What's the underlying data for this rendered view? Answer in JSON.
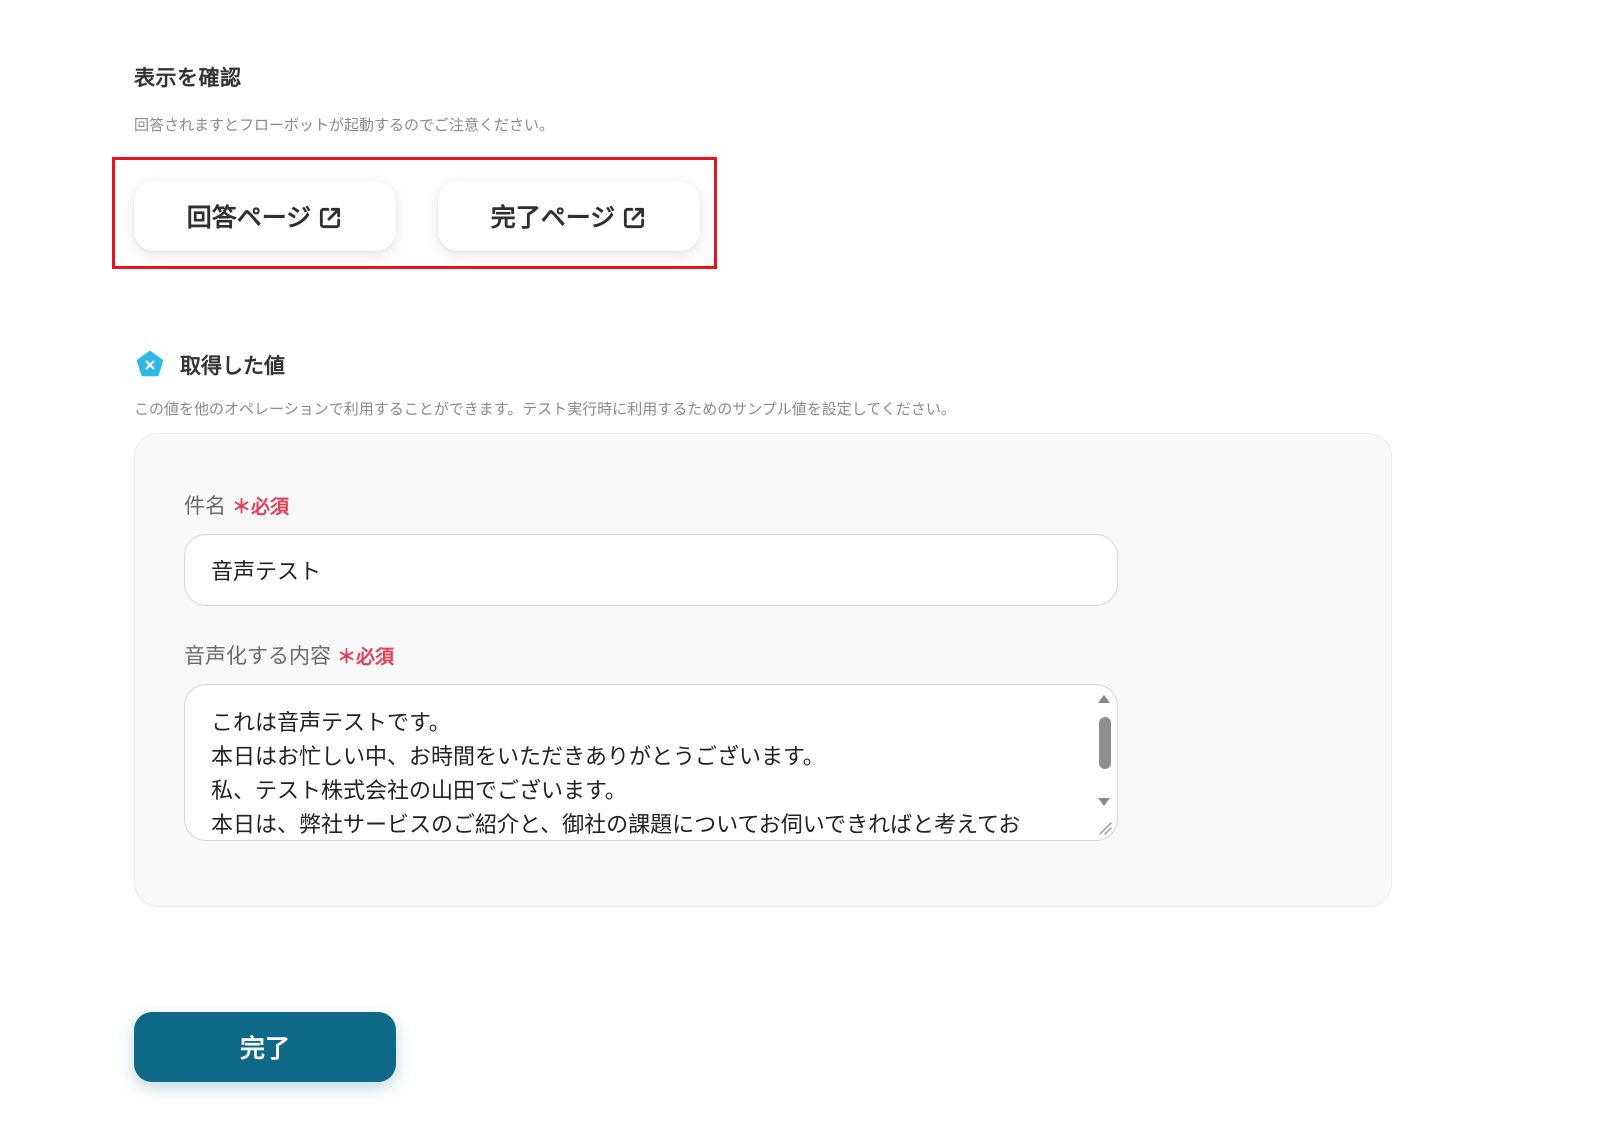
{
  "display_check": {
    "title": "表示を確認",
    "description": "回答されますとフローボットが起動するのでご注意ください。",
    "answer_page_label": "回答ページ",
    "complete_page_label": "完了ページ",
    "link_icon": "external-link-icon",
    "highlight_color": "#e8141c"
  },
  "values": {
    "icon": "pentagon-x-icon",
    "icon_color": "#2fb7e8",
    "title": "取得した値",
    "description": "この値を他のオペレーションで利用することができます。テスト実行時に利用するためのサンプル値を設定してください。",
    "fields": {
      "subject": {
        "label": "件名",
        "required_mark": "＊",
        "required_label": "必須",
        "value": "音声テスト"
      },
      "content": {
        "label": "音声化する内容",
        "required_mark": "＊",
        "required_label": "必須",
        "lines": [
          "これは音声テストです。",
          "本日はお忙しい中、お時間をいただきありがとうございます。",
          "私、テスト株式会社の山田でございます。",
          "本日は、弊社サービスのご紹介と、御社の課題についてお伺いできればと考えてお"
        ]
      }
    }
  },
  "footer": {
    "done_label": "完了",
    "accent_color": "#0d6986"
  }
}
